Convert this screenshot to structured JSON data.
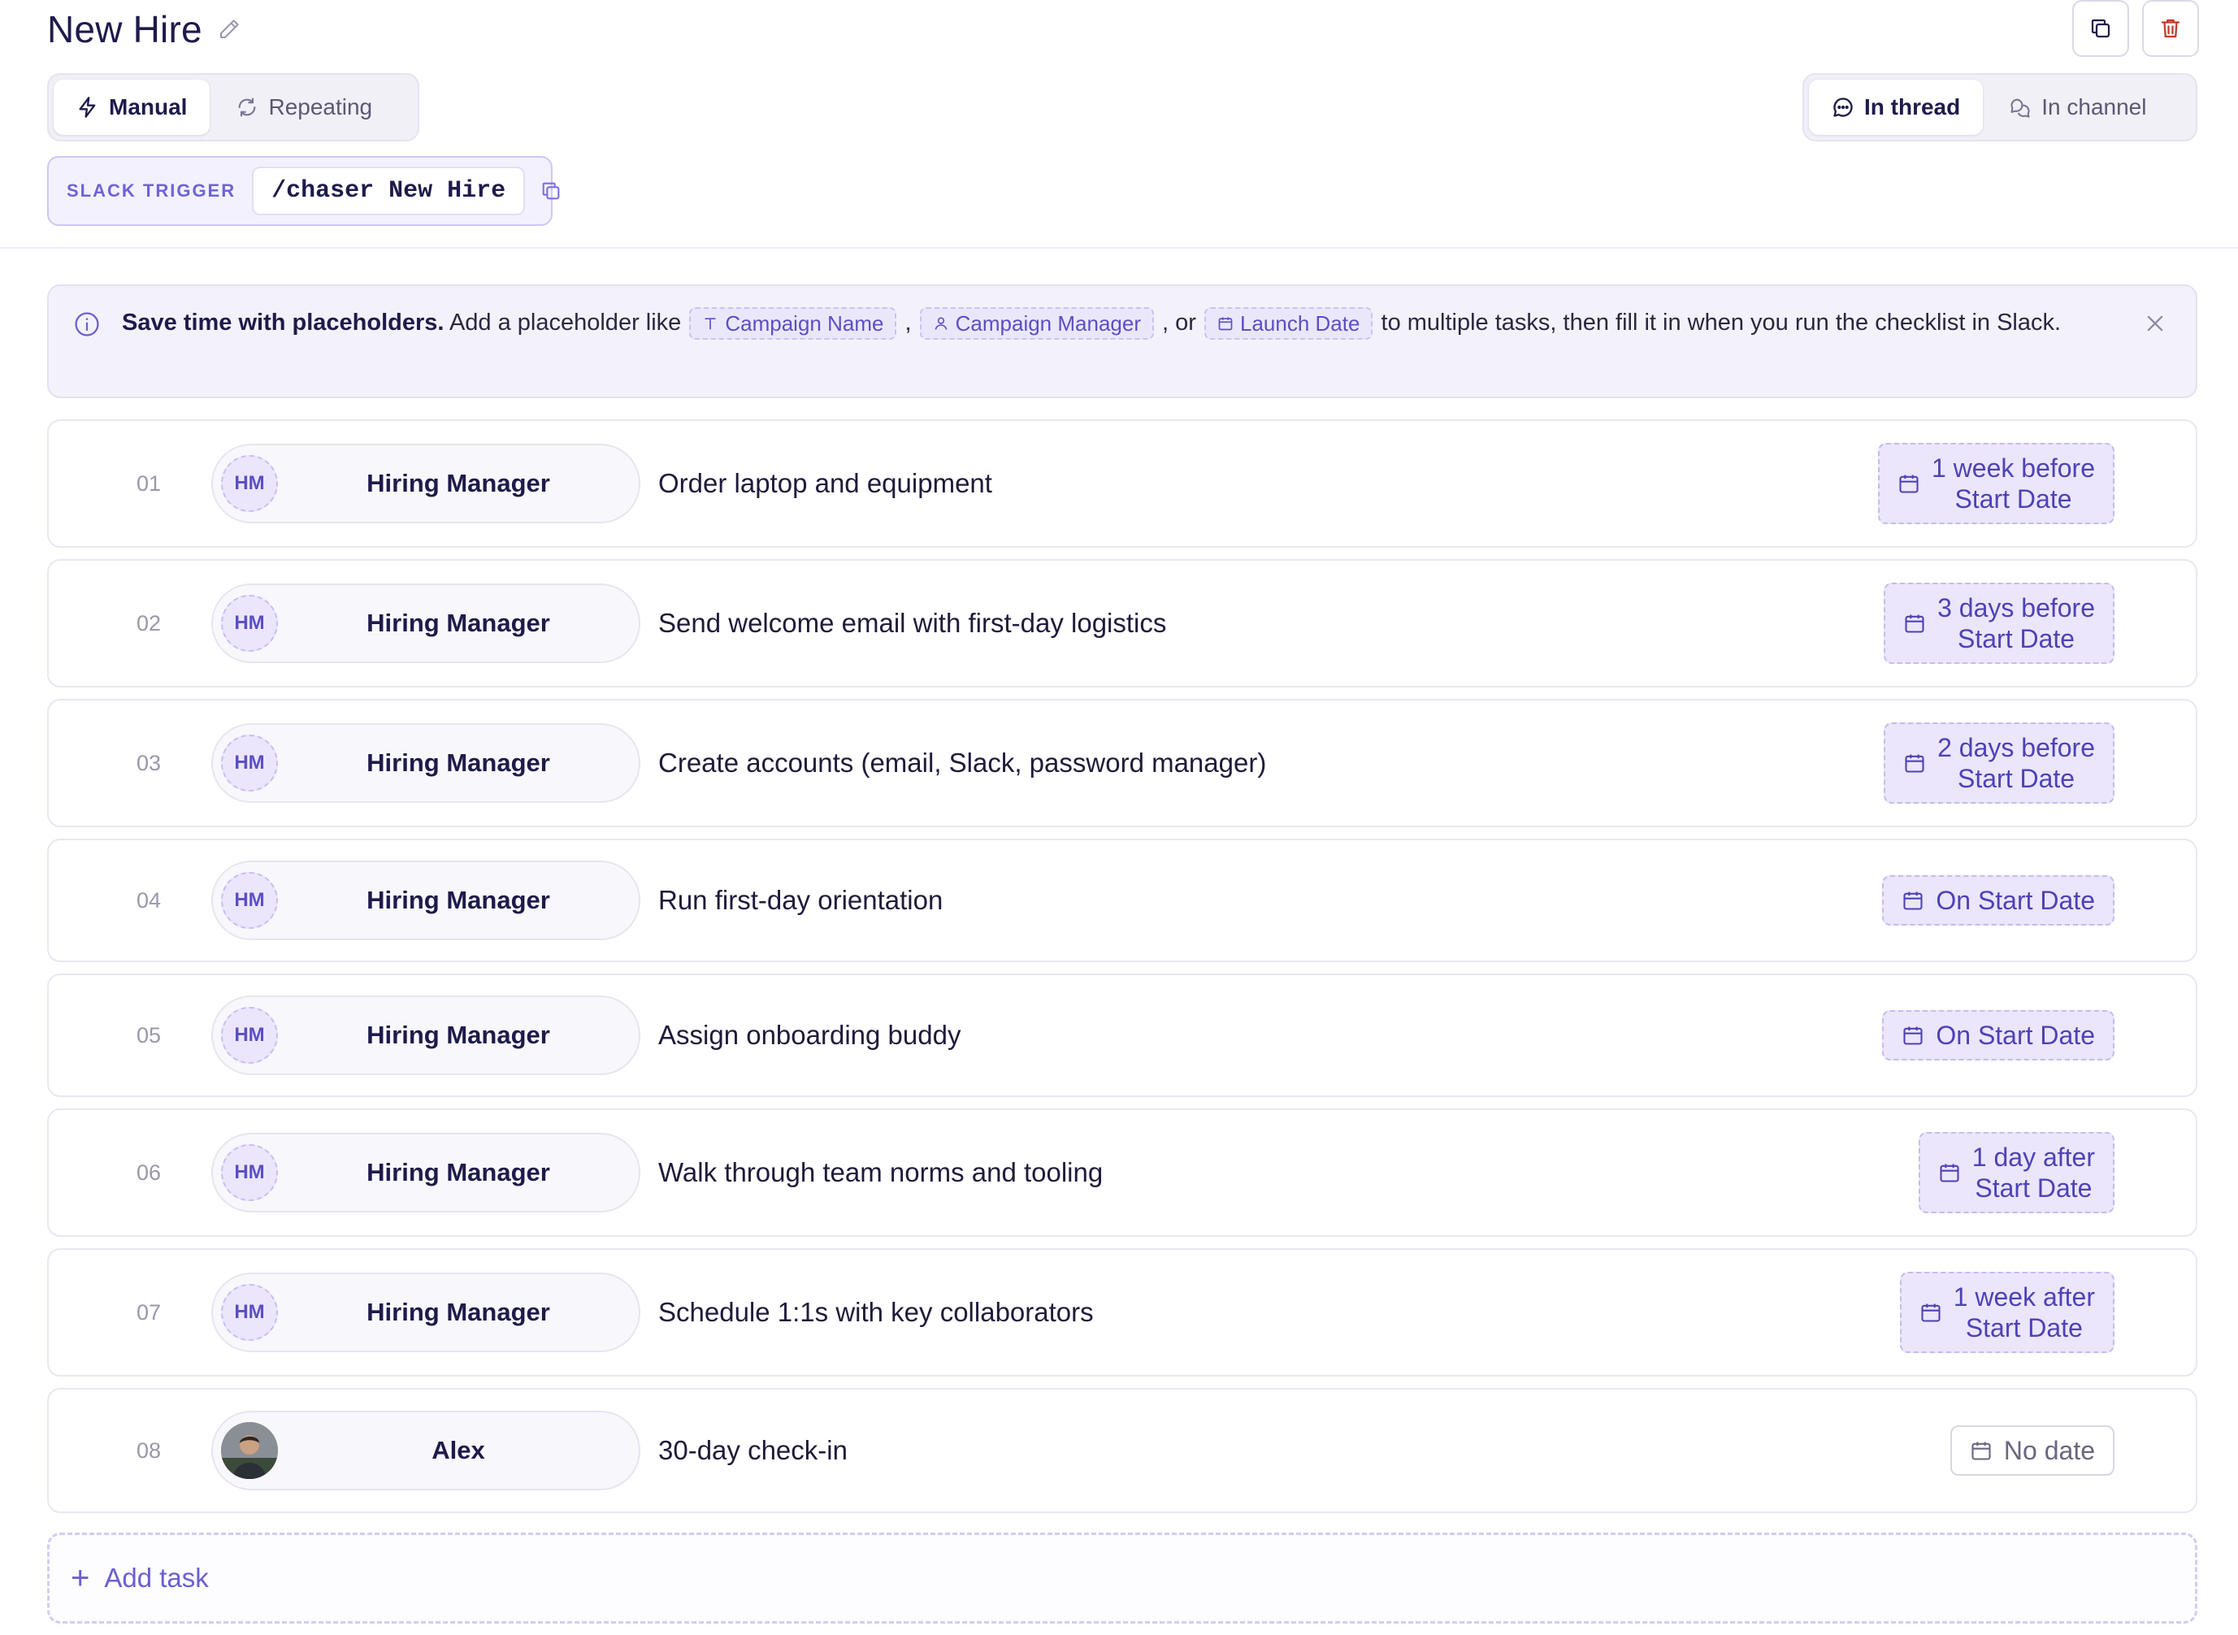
{
  "header": {
    "title": "New Hire"
  },
  "mode_toggle": {
    "manual_label": "Manual",
    "repeating_label": "Repeating",
    "selected": "Manual"
  },
  "post_toggle": {
    "thread_label": "In thread",
    "channel_label": "In channel",
    "selected": "In thread"
  },
  "trigger": {
    "label": "SLACK TRIGGER",
    "command": "/chaser New Hire"
  },
  "banner": {
    "bold": "Save time with placeholders.",
    "lead": " Add a placeholder like ",
    "chip1": "Campaign Name",
    "sep1": " , ",
    "chip2": "Campaign Manager",
    "sep2": " , or ",
    "chip3": "Launch Date",
    "tail": " to multiple tasks, then fill it in when you run the checklist in Slack."
  },
  "tasks": [
    {
      "num": "01",
      "initials": "HM",
      "assignee": "Hiring Manager",
      "title": "Order laptop and equipment",
      "due_line1": "1 week before",
      "due_line2": "Start Date"
    },
    {
      "num": "02",
      "initials": "HM",
      "assignee": "Hiring Manager",
      "title": "Send welcome email with first-day logistics",
      "due_line1": "3 days before",
      "due_line2": "Start Date"
    },
    {
      "num": "03",
      "initials": "HM",
      "assignee": "Hiring Manager",
      "title": "Create accounts (email, Slack, password manager)",
      "due_line1": "2 days before",
      "due_line2": "Start Date"
    },
    {
      "num": "04",
      "initials": "HM",
      "assignee": "Hiring Manager",
      "title": "Run first-day orientation",
      "due_line1": "On Start Date",
      "due_line2": ""
    },
    {
      "num": "05",
      "initials": "HM",
      "assignee": "Hiring Manager",
      "title": "Assign onboarding buddy",
      "due_line1": "On Start Date",
      "due_line2": ""
    },
    {
      "num": "06",
      "initials": "HM",
      "assignee": "Hiring Manager",
      "title": "Walk through team norms and tooling",
      "due_line1": "1 day after",
      "due_line2": "Start Date"
    },
    {
      "num": "07",
      "initials": "HM",
      "assignee": "Hiring Manager",
      "title": "Schedule 1:1s with key collaborators",
      "due_line1": "1 week after",
      "due_line2": "Start Date"
    },
    {
      "num": "08",
      "initials": "",
      "assignee": "Alex",
      "title": "30-day check-in",
      "due_line1": "No date",
      "due_line2": ""
    }
  ],
  "add_task": {
    "label": "Add task"
  },
  "icons": {
    "edit": "pencil-icon",
    "copy": "copy-icon",
    "delete": "trash-icon",
    "manual": "lightning-icon",
    "repeating": "refresh-icon",
    "thread": "chat-bubble-icon",
    "channel": "chat-bubbles-icon",
    "info": "info-icon",
    "close": "close-icon",
    "due": "calendar-icon",
    "add": "plus-icon"
  },
  "colors": {
    "accent": "#5b4fc4",
    "title": "#1e1b4b",
    "delete": "#c0392b",
    "chip_bg": "#ebe6fb"
  }
}
